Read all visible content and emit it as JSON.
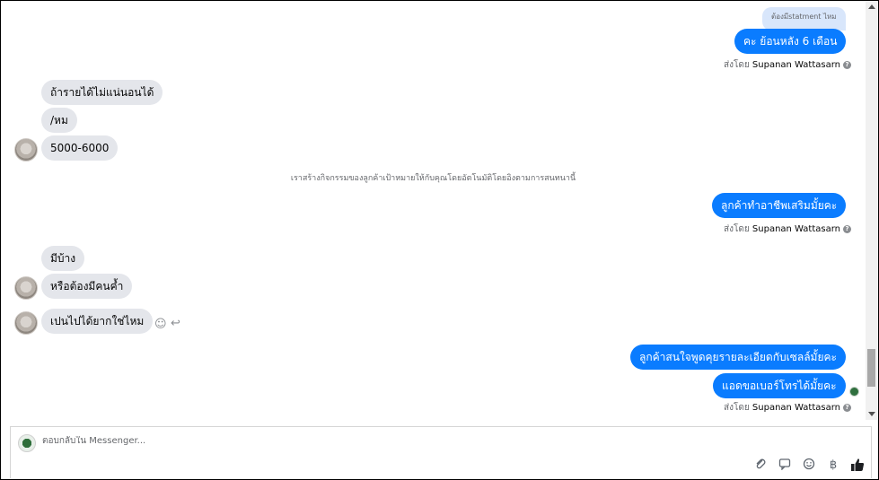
{
  "reply_quote": "ต้องมีstatment ไหม",
  "sent_by_prefix": "ส่งโดย",
  "sender_name": "Supanan Wattasarn",
  "help_glyph": "?",
  "messages": [
    {
      "dir": "out",
      "text": "คะ ย้อนหลัง 6 เดือน"
    },
    {
      "dir": "in",
      "text": "ถ้ารายได้ไม่แน่นอนได้"
    },
    {
      "dir": "in",
      "text": "/หม"
    },
    {
      "dir": "in",
      "text": "5000-6000"
    },
    {
      "dir": "out",
      "text": "ลูกค้าทำอาชีพเสริมมั้ยคะ"
    },
    {
      "dir": "in",
      "text": "มีบ้าง"
    },
    {
      "dir": "in",
      "text": "หรือต้องมีคนค้ำ"
    },
    {
      "dir": "in",
      "text": "เปนไปได้ยากใช่ไหม"
    },
    {
      "dir": "out",
      "text": "ลูกค้าสนใจพูดคุยรายละเอียดกับเซลล์มั้ยคะ"
    },
    {
      "dir": "out",
      "text": "แอดขอเบอร์โทรได้มั้ยคะ"
    }
  ],
  "system_note": "เราสร้างกิจกรรมของลูกค้าเป้าหมายให้กับคุณโดยอัตโนมัติโดยอิงตามการสนทนานี้",
  "icons": {
    "react": "smiley-icon",
    "reply": "reply-arrow-icon",
    "attach": "paperclip-icon",
    "sticker": "sticker-icon",
    "emoji": "emoji-icon",
    "payment": "baht-icon",
    "like": "thumbs-up-icon"
  },
  "composer": {
    "placeholder": "ตอบกลับใน Messenger..."
  },
  "colors": {
    "outgoing": "#0a7cff",
    "incoming": "#e4e6eb",
    "quote": "#d8e6fb"
  }
}
